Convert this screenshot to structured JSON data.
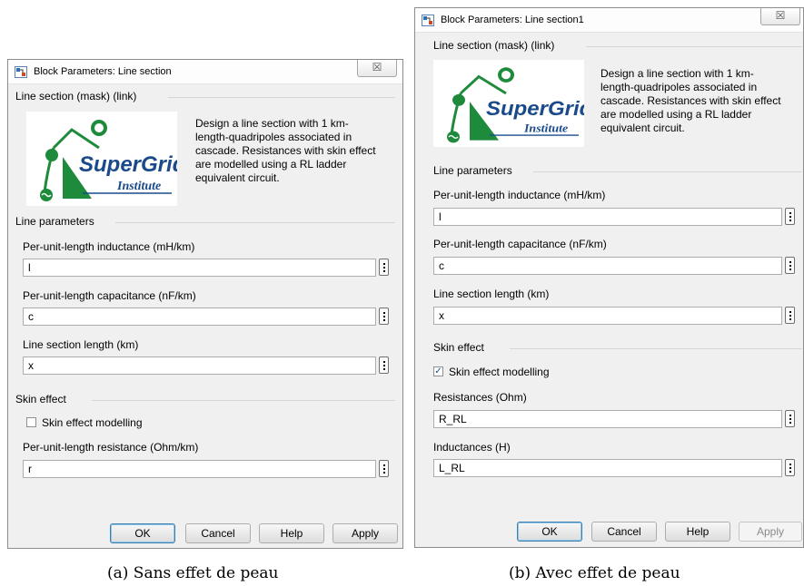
{
  "dialog_a": {
    "title": "Block Parameters: Line section",
    "close_glyph": "☒",
    "mask_header": "Line section (mask) (link)",
    "logo_name": "SuperGrid",
    "logo_sub": "Institute",
    "description_lines": [
      "Design a line section with 1 km-",
      "length-quadripoles associated in",
      "cascade. Resistances with skin effect",
      "are modelled using a RL ladder",
      "equivalent circuit."
    ],
    "line_params_header": "Line parameters",
    "inductance_label": "Per-unit-length inductance (mH/km)",
    "inductance_value": "l",
    "capacitance_label": "Per-unit-length capacitance (nF/km)",
    "capacitance_value": "c",
    "length_label": "Line section length (km)",
    "length_value": "x",
    "skin_header": "Skin effect",
    "skin_checkbox_label": "Skin effect modelling",
    "skin_checked": false,
    "resistance_label": "Per-unit-length resistance (Ohm/km)",
    "resistance_value": "r",
    "buttons": {
      "ok": "OK",
      "cancel": "Cancel",
      "help": "Help",
      "apply": "Apply"
    }
  },
  "dialog_b": {
    "title": "Block Parameters: Line section1",
    "close_glyph": "☒",
    "mask_header": "Line section (mask) (link)",
    "logo_name": "SuperGrid",
    "logo_sub": "Institute",
    "description_lines": [
      "Design a line section with 1 km-",
      "length-quadripoles associated in",
      "cascade. Resistances with skin effect",
      "are modelled using a RL ladder",
      "equivalent circuit."
    ],
    "line_params_header": "Line parameters",
    "inductance_label": "Per-unit-length inductance (mH/km)",
    "inductance_value": "l",
    "capacitance_label": "Per-unit-length capacitance (nF/km)",
    "capacitance_value": "c",
    "length_label": "Line section length (km)",
    "length_value": "x",
    "skin_header": "Skin effect",
    "skin_checkbox_label": "Skin effect modelling",
    "skin_checked": true,
    "resistances_label": "Resistances (Ohm)",
    "resistances_value": "R_RL",
    "inductances_label": "Inductances (H)",
    "inductances_value": "L_RL",
    "buttons": {
      "ok": "OK",
      "cancel": "Cancel",
      "help": "Help",
      "apply": "Apply"
    }
  },
  "captions": {
    "a": "(a) Sans effet de peau",
    "b": "(b) Avec effet de peau"
  },
  "colors": {
    "logo_green": "#1e8b3c",
    "logo_blue": "#1a4a8a",
    "dialog_bg": "#f0f0f0"
  },
  "icons": {
    "app": "simulink-block-icon",
    "dots": "ellipsis-vertical-icon"
  }
}
